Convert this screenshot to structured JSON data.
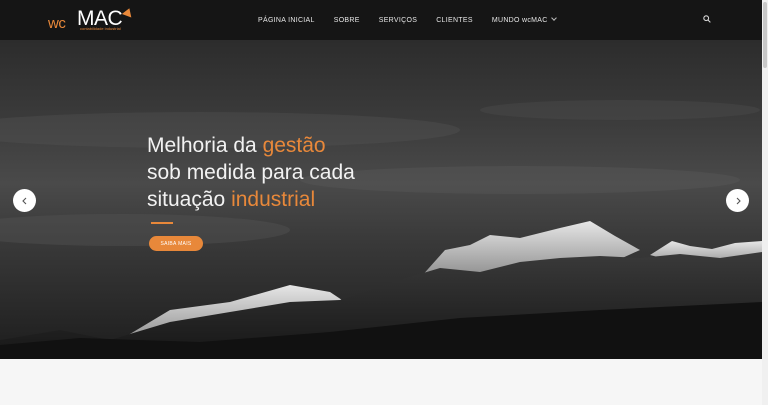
{
  "logo": {
    "prefix": "wc",
    "name": "MAC",
    "tagline": "contabilidade industrial"
  },
  "nav": {
    "items": [
      {
        "label": "PÁGINA INICIAL"
      },
      {
        "label": "SOBRE"
      },
      {
        "label": "SERVIÇOS"
      },
      {
        "label": "CLIENTES"
      },
      {
        "label": "MUNDO wcMAC"
      }
    ],
    "search_icon": "search-icon"
  },
  "hero": {
    "headline_line1_a": "Melhoria da ",
    "headline_line1_b": "gestão",
    "headline_line2": "sob medida para cada",
    "headline_line3_a": "situação ",
    "headline_line3_b": "industrial",
    "cta_label": "SAIBA MAIS",
    "prev_icon": "chevron-left-icon",
    "next_icon": "chevron-right-icon"
  },
  "colors": {
    "accent": "#e8883a",
    "header_bg": "#151515",
    "text_light": "#f2f2f2"
  }
}
